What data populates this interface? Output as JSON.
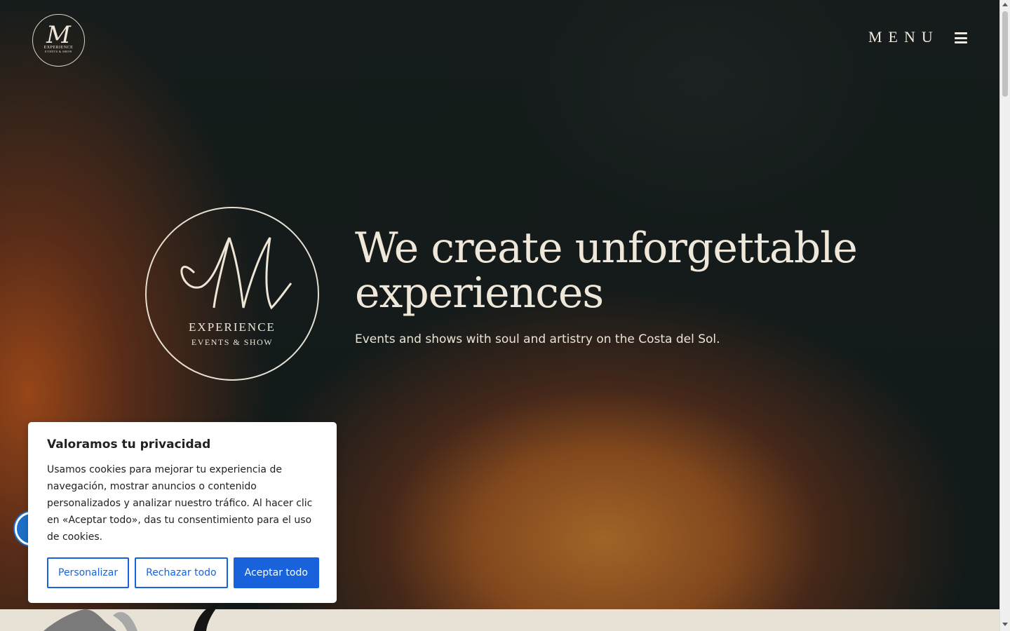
{
  "brand": {
    "monogram": "M",
    "line1": "EXPERIENCE",
    "line2": "EVENTS & SHOW"
  },
  "nav": {
    "menu_label": "MENU",
    "menu_icon": "hamburger-icon"
  },
  "hero": {
    "headline": "We create unforgettable experiences",
    "subline": "Events and shows with soul and artistry on the Costa del Sol."
  },
  "cookie_banner": {
    "title": "Valoramos tu privacidad",
    "body": "Usamos cookies para mejorar tu experiencia de navegación, mostrar anuncios o contenido personalizados y analizar nuestro tráfico. Al hacer clic en «Aceptar todo», das tu consentimiento para el uso de cookies.",
    "customize_label": "Personalizar",
    "reject_label": "Rechazar todo",
    "accept_label": "Aceptar todo"
  },
  "accessibility": {
    "icon": "accessibility-icon"
  },
  "colors": {
    "primary_button": "#1863dc",
    "hero_dark": "#151c1b",
    "hero_orange": "#a86828",
    "cream_text": "#efe8da",
    "footer_strip": "#e8e2d6"
  }
}
